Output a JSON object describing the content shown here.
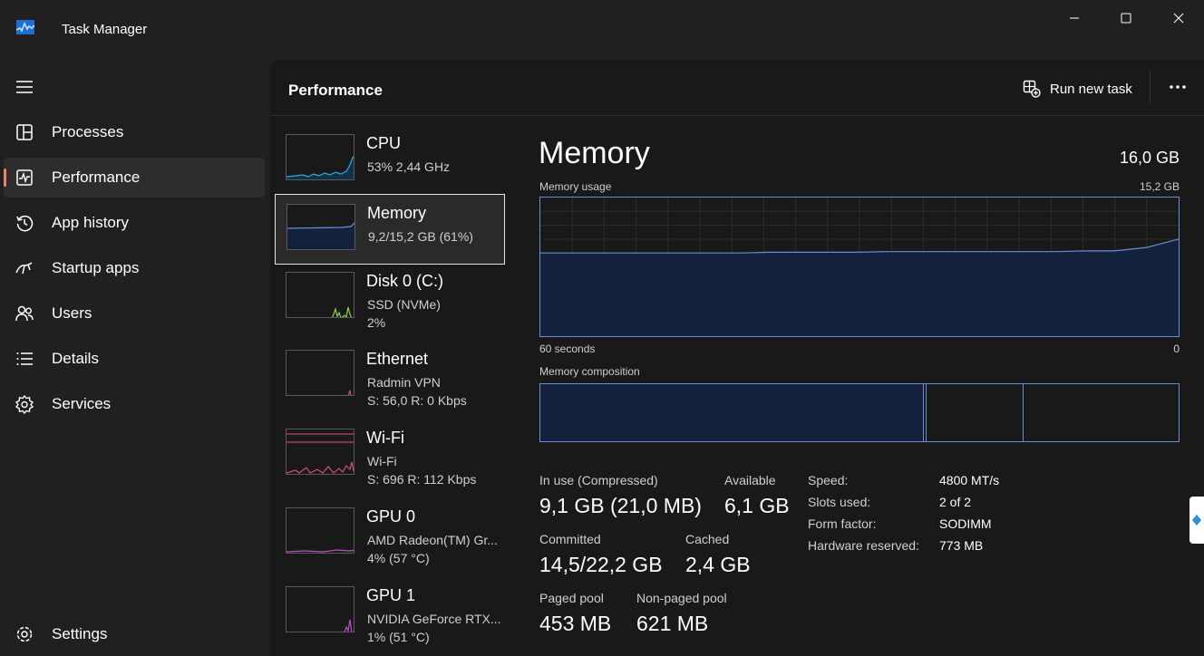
{
  "window": {
    "title": "Task Manager",
    "controls": [
      "minimize",
      "maximize",
      "close"
    ]
  },
  "nav": {
    "items": [
      {
        "label": "Processes",
        "icon": "processes-icon"
      },
      {
        "label": "Performance",
        "icon": "performance-icon",
        "active": true
      },
      {
        "label": "App history",
        "icon": "history-icon"
      },
      {
        "label": "Startup apps",
        "icon": "startup-icon"
      },
      {
        "label": "Users",
        "icon": "users-icon"
      },
      {
        "label": "Details",
        "icon": "details-icon"
      },
      {
        "label": "Services",
        "icon": "services-icon"
      }
    ],
    "settings": {
      "label": "Settings",
      "icon": "gear-icon"
    }
  },
  "header": {
    "title": "Performance",
    "run_task_label": "Run new task"
  },
  "resources": [
    {
      "name": "CPU",
      "line1": "53%  2,44 GHz",
      "line2": "",
      "color": "#3aa7d9"
    },
    {
      "name": "Memory",
      "line1": "9,2/15,2 GB (61%)",
      "line2": "",
      "color": "#6a8bd6",
      "selected": true
    },
    {
      "name": "Disk 0 (C:)",
      "line1": "SSD (NVMe)",
      "line2": "2%",
      "color": "#8fd14f"
    },
    {
      "name": "Ethernet",
      "line1": "Radmin VPN",
      "line2": "S: 56,0  R: 0 Kbps",
      "color": "#c9517a"
    },
    {
      "name": "Wi-Fi",
      "line1": "Wi-Fi",
      "line2": "S: 696  R: 112 Kbps",
      "color": "#e0508a"
    },
    {
      "name": "GPU 0",
      "line1": "AMD Radeon(TM) Gr...",
      "line2": "4%  (57 °C)",
      "color": "#b94fc4"
    },
    {
      "name": "GPU 1",
      "line1": "NVIDIA GeForce RTX...",
      "line2": "1%  (51 °C)",
      "color": "#b94fc4"
    }
  ],
  "detail": {
    "title": "Memory",
    "total": "16,0 GB",
    "usage_label": "Memory usage",
    "usage_max": "15,2 GB",
    "time_left": "60 seconds",
    "time_right": "0",
    "composition_label": "Memory composition",
    "usage_series": [
      0.6,
      0.6,
      0.6,
      0.6,
      0.6,
      0.6,
      0.6,
      0.6,
      0.605,
      0.605,
      0.605,
      0.605,
      0.61,
      0.61,
      0.61,
      0.61,
      0.61,
      0.61,
      0.61,
      0.615,
      0.615,
      0.64,
      0.7
    ]
  },
  "stats": {
    "in_use_label": "In use (Compressed)",
    "in_use_value": "9,1 GB (21,0 MB)",
    "available_label": "Available",
    "available_value": "6,1 GB",
    "committed_label": "Committed",
    "committed_value": "14,5/22,2 GB",
    "cached_label": "Cached",
    "cached_value": "2,4 GB",
    "paged_label": "Paged pool",
    "paged_value": "453 MB",
    "nonpaged_label": "Non-paged pool",
    "nonpaged_value": "621 MB"
  },
  "specs": {
    "speed_label": "Speed:",
    "speed_value": "4800 MT/s",
    "slots_label": "Slots used:",
    "slots_value": "2 of 2",
    "form_label": "Form factor:",
    "form_value": "SODIMM",
    "reserved_label": "Hardware reserved:",
    "reserved_value": "773 MB"
  },
  "colors": {
    "accent": "#e2876a",
    "memory_line": "#6a8bd6",
    "memory_fill": "#14213d"
  }
}
